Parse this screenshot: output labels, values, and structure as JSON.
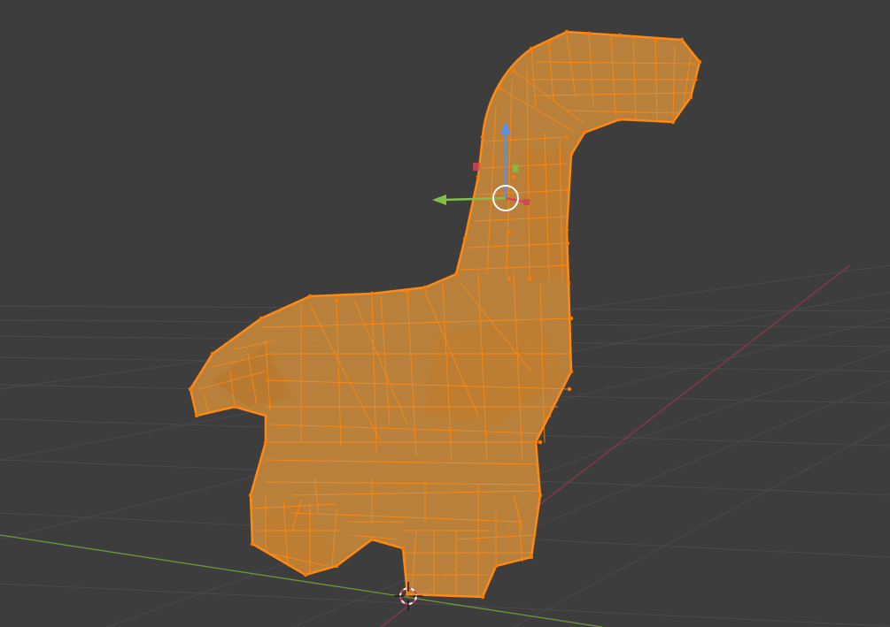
{
  "viewport": {
    "background": "#3d3d3d",
    "grid_color": "#4a4a4a",
    "x_axis_color": "#8a3a44",
    "y_axis_color": "#6b9a3a",
    "selection_color": "#ff8a12",
    "selection_fill": "#e89a3a",
    "vertex_color": "#ff7a00",
    "shading": "wireframe-xray",
    "object": {
      "type": "mesh",
      "shape": "dinosaur",
      "selected": true,
      "mode": "edit"
    },
    "gizmo": {
      "type": "move",
      "z_color": "#5b8ee6",
      "y_color": "#7fc04a",
      "x_color": "#d6455f",
      "center_color": "#ffffff"
    },
    "cursor_3d": {
      "icon": "3d-cursor-icon"
    }
  }
}
